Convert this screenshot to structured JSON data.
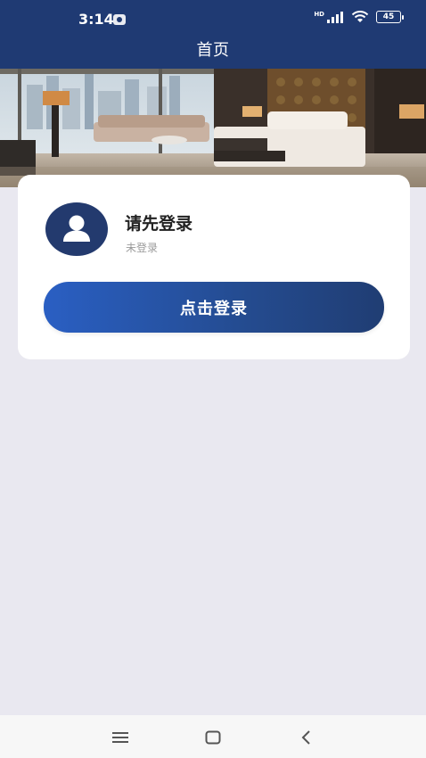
{
  "status_bar": {
    "time": "3:14",
    "hd_label": "HD",
    "battery": "45"
  },
  "header": {
    "title": "首页"
  },
  "profile": {
    "name": "请先登录",
    "status": "未登录",
    "login_button_label": "点击登录"
  },
  "colors": {
    "primary": "#1f3a73",
    "button_gradient_start": "#2a5fc3",
    "button_gradient_end": "#203d73",
    "background": "#e9e8f0"
  },
  "icons": {
    "avatar": "user-icon",
    "nav_menu": "menu-icon",
    "nav_home": "home-square-icon",
    "nav_back": "back-chevron-icon"
  }
}
